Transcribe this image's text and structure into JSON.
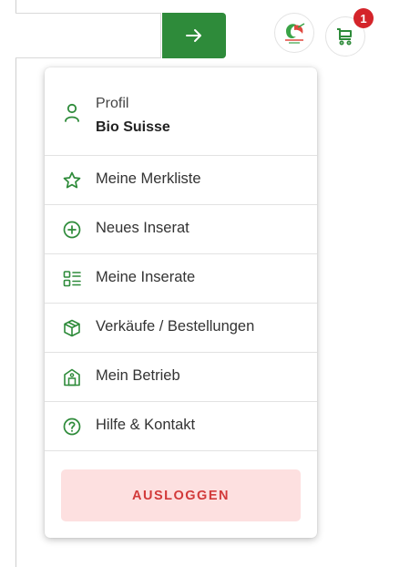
{
  "header": {
    "search_placeholder": "",
    "search_button_icon": "arrow-right-icon",
    "logo_icon": "bio-suisse-logo",
    "cart_icon": "cart-icon",
    "cart_badge": "1"
  },
  "menu": {
    "profile_label": "Profil",
    "profile_name": "Bio Suisse",
    "items": [
      {
        "label": "Meine Merkliste",
        "icon": "star-icon"
      },
      {
        "label": "Neues Inserat",
        "icon": "plus-circle-icon"
      },
      {
        "label": "Meine Inserate",
        "icon": "list-icon"
      },
      {
        "label": "Verkäufe / Bestellungen",
        "icon": "package-icon"
      },
      {
        "label": "Mein Betrieb",
        "icon": "barn-icon"
      },
      {
        "label": "Hilfe & Kontakt",
        "icon": "help-circle-icon"
      }
    ],
    "logout_label": "AUSLOGGEN"
  },
  "colors": {
    "brand_green": "#2e8b3a",
    "logout_bg": "#fde0e0",
    "logout_text": "#d23a3a",
    "badge_red": "#d4242a"
  }
}
